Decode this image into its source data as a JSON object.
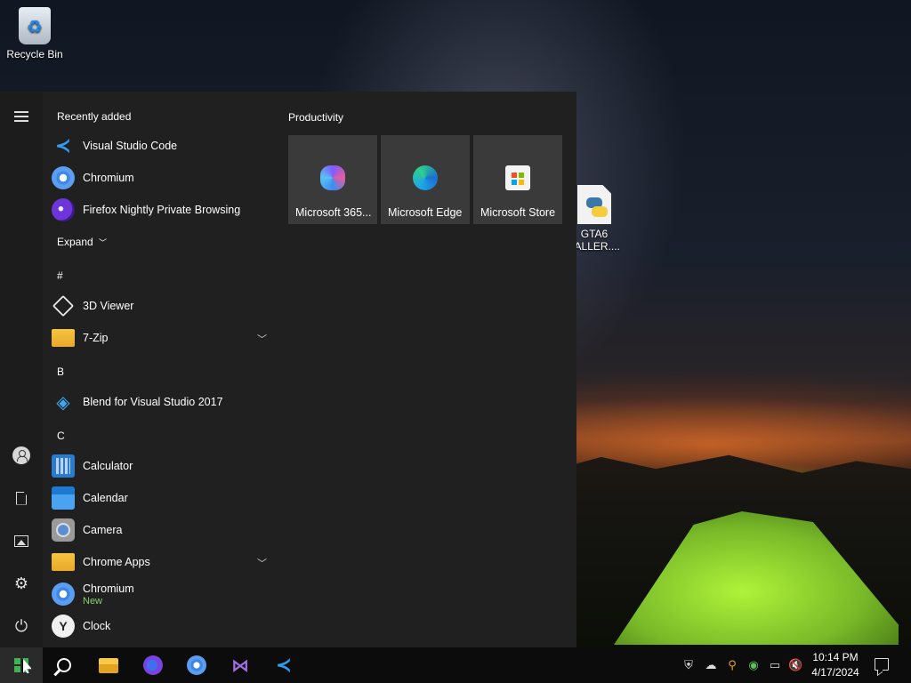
{
  "desktop": {
    "icons": [
      {
        "label": "Recycle Bin",
        "icon": "recycle-bin-icon"
      },
      {
        "label_line1": "GTA6",
        "label_line2": "TALLER....",
        "icon": "python-file-icon"
      }
    ]
  },
  "start_menu": {
    "rail": {
      "menu_icon": "hamburger-icon",
      "bottom": [
        "account-icon",
        "documents-icon",
        "pictures-icon",
        "settings-icon",
        "power-icon"
      ]
    },
    "recently_added": {
      "header": "Recently added",
      "items": [
        {
          "label": "Visual Studio Code",
          "icon": "vscode-icon"
        },
        {
          "label": "Chromium",
          "icon": "chromium-icon"
        },
        {
          "label": "Firefox Nightly Private Browsing",
          "icon": "firefox-private-icon"
        }
      ],
      "expand_label": "Expand"
    },
    "groups": [
      {
        "letter": "#",
        "items": [
          {
            "label": "3D Viewer",
            "icon": "3d-viewer-icon"
          },
          {
            "label": "7-Zip",
            "icon": "folder-icon",
            "expandable": true
          }
        ]
      },
      {
        "letter": "B",
        "items": [
          {
            "label": "Blend for Visual Studio 2017",
            "icon": "blend-icon"
          }
        ]
      },
      {
        "letter": "C",
        "items": [
          {
            "label": "Calculator",
            "icon": "calculator-icon"
          },
          {
            "label": "Calendar",
            "icon": "calendar-icon"
          },
          {
            "label": "Camera",
            "icon": "camera-icon"
          },
          {
            "label": "Chrome Apps",
            "icon": "folder-icon",
            "expandable": true
          },
          {
            "label": "Chromium",
            "sub": "New",
            "icon": "chromium-icon"
          },
          {
            "label": "Clock",
            "icon": "clock-icon"
          }
        ]
      }
    ],
    "tiles": {
      "group_title": "Productivity",
      "items": [
        {
          "label": "Microsoft 365...",
          "icon": "microsoft-365-icon"
        },
        {
          "label": "Microsoft Edge",
          "icon": "edge-icon"
        },
        {
          "label": "Microsoft Store",
          "icon": "store-icon"
        }
      ]
    }
  },
  "taskbar": {
    "apps": [
      "start-icon",
      "search-icon",
      "file-explorer-icon",
      "firefox-icon",
      "chromium-icon",
      "visual-studio-icon",
      "vscode-icon"
    ],
    "tray": [
      "security-icon",
      "onedrive-offline-icon",
      "search-tool-icon",
      "network-share-icon",
      "network-icon",
      "volume-muted-icon"
    ],
    "clock_time": "10:14 PM",
    "clock_date": "4/17/2024",
    "notifications_icon": "action-center-icon"
  },
  "colors": {
    "start_bg": "#202020",
    "tile_bg": "#3a3a3a",
    "taskbar_bg": "#0c0c0c",
    "new_badge": "#86d36b"
  }
}
